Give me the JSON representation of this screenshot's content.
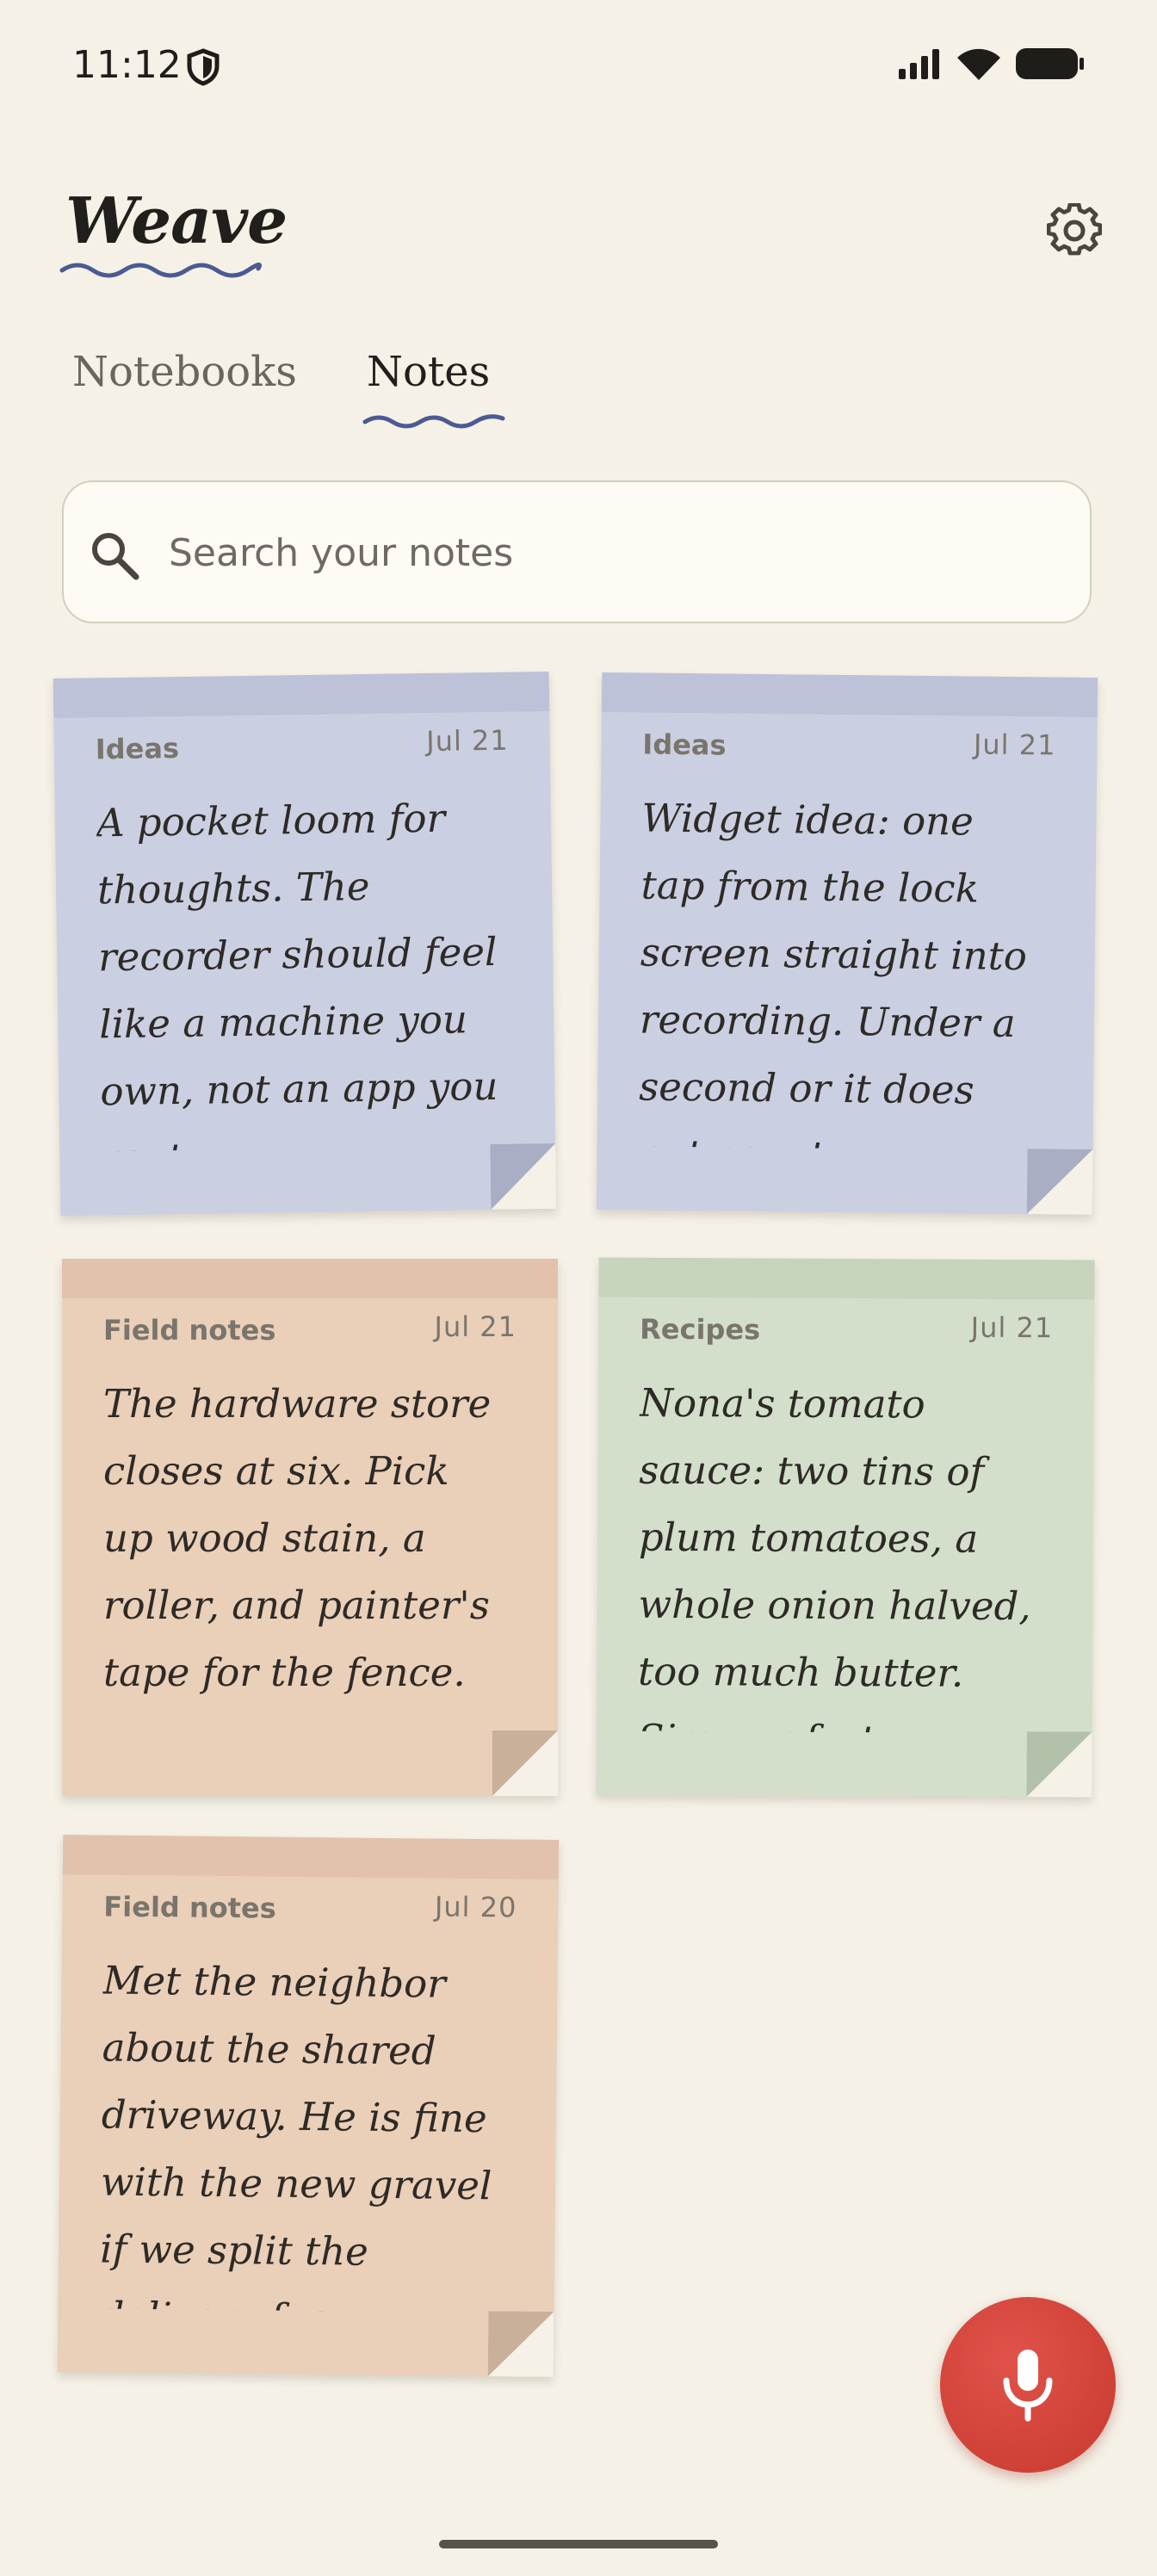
{
  "status": {
    "time": "11:12"
  },
  "app": {
    "title": "Weave"
  },
  "tabs": [
    {
      "label": "Notebooks",
      "active": false
    },
    {
      "label": "Notes",
      "active": true
    }
  ],
  "search": {
    "placeholder": "Search your notes",
    "value": ""
  },
  "notes": [
    {
      "notebook": "Ideas",
      "date": "Jul 21",
      "text": "A pocket loom for thoughts. The recorder should feel like a machine you own, not an app you rent.",
      "color": "#cbcfe2"
    },
    {
      "notebook": "Ideas",
      "date": "Jul 21",
      "text": "Widget idea: one tap from the lock screen straight into recording. Under a second or it does not count.",
      "color": "#cbcfe2"
    },
    {
      "notebook": "Field notes",
      "date": "Jul 21",
      "text": "The hardware store closes at six. Pick up wood stain, a roller, and painter's tape for the fence.",
      "color": "#eacfb9"
    },
    {
      "notebook": "Recipes",
      "date": "Jul 21",
      "text": "Nona's tomato sauce: two tins of plum tomatoes, a whole onion halved, too much butter. Simmer forty minutes.",
      "color": "#d3dfcb"
    },
    {
      "notebook": "Field notes",
      "date": "Jul 20",
      "text": "Met the neighbor about the shared driveway. He is fine with the new gravel if we split the delivery fee.",
      "color": "#eacfb9"
    }
  ],
  "icons": {
    "shield": "shield-icon",
    "signal": "signal-icon",
    "wifi": "wifi-icon",
    "battery": "battery-icon",
    "settings": "gear-icon",
    "search": "search-icon",
    "mic": "microphone-icon"
  },
  "colors": {
    "accent": "#4a5a93",
    "fab": "#d4433a",
    "background": "#f5f1e7"
  }
}
